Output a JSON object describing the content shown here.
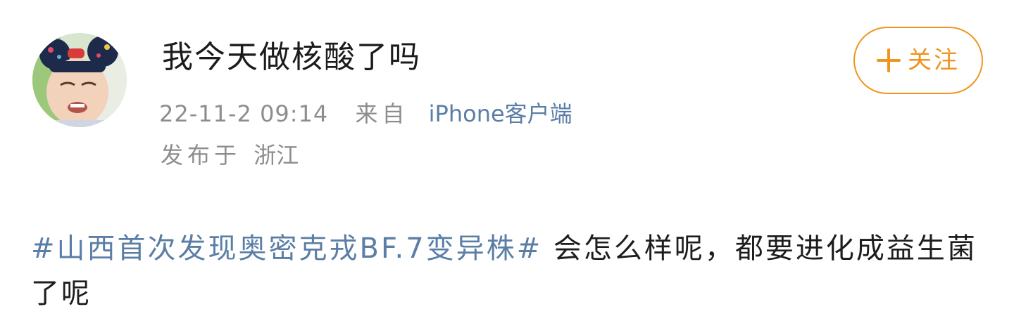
{
  "post": {
    "author": {
      "username": "我今天做核酸了吗"
    },
    "meta": {
      "time": "22-11-2 09:14",
      "from_label": "来自",
      "client": "iPhone客户端"
    },
    "location": {
      "prefix": "发布于",
      "place": "浙江"
    },
    "follow": {
      "icon": "plus-icon",
      "label": "关注"
    },
    "content": {
      "topic": "#山西首次发现奥密克戎BF.7变异株#",
      "text": " 会怎么样呢，都要进化成益生菌了呢"
    }
  },
  "colors": {
    "link": "#5a7ea6",
    "accent": "#f0941f",
    "meta": "#8d8d8d",
    "text": "#1d1d1d"
  }
}
